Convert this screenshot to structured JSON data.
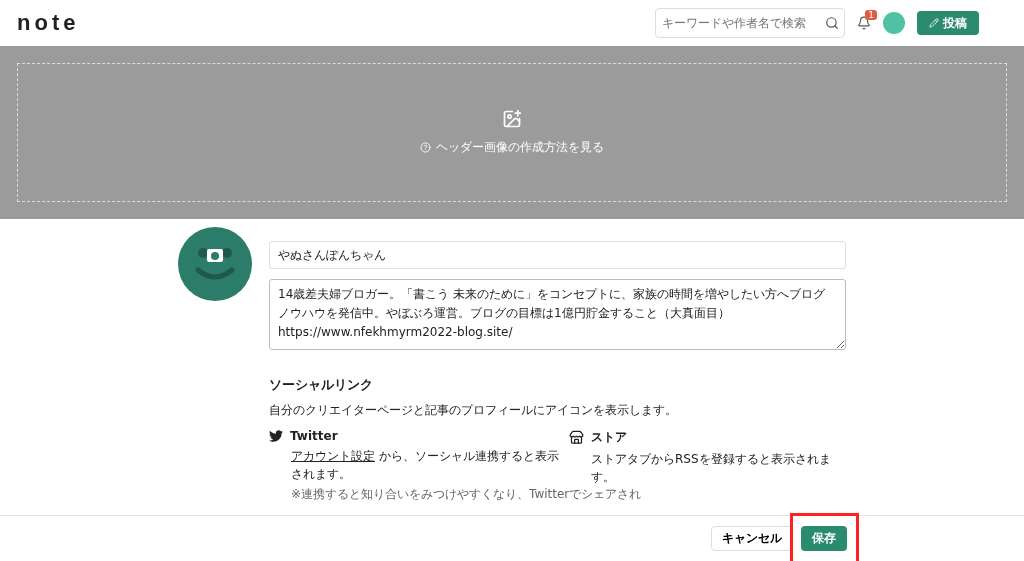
{
  "header": {
    "logo": "note",
    "search": {
      "placeholder": "キーワードや作者名で検索"
    },
    "notifications": {
      "count": "1"
    },
    "post_button": "投稿"
  },
  "banner": {
    "help_link": "ヘッダー画像の作成方法を見る"
  },
  "profile": {
    "name": "やぬさんぽんちゃん",
    "bio": "14歳差夫婦ブロガー。「書こう 未来のために」をコンセプトに、家族の時間を増やしたい方へブログノウハウを発信中。やぼぶろ運営。ブログの目標は1億円貯金すること（大真面目）https://www.nfekhmyrm2022-blog.site/"
  },
  "social": {
    "title": "ソーシャルリンク",
    "description": "自分のクリエイターページと記事のプロフィールにアイコンを表示します。",
    "items": [
      {
        "kind": "twitter",
        "name": "Twitter",
        "link": "アカウント設定",
        "text": "から、ソーシャル連携すると表示されます。",
        "note": "※連携すると知り合いをみつけやすくなり、Twitterでシェアされ"
      },
      {
        "kind": "store",
        "name": "ストア",
        "text": "ストアタブからRSSを登録すると表示されます。"
      }
    ]
  },
  "footer": {
    "cancel": "キャンセル",
    "save": "保存",
    "save_highlighted": true
  }
}
